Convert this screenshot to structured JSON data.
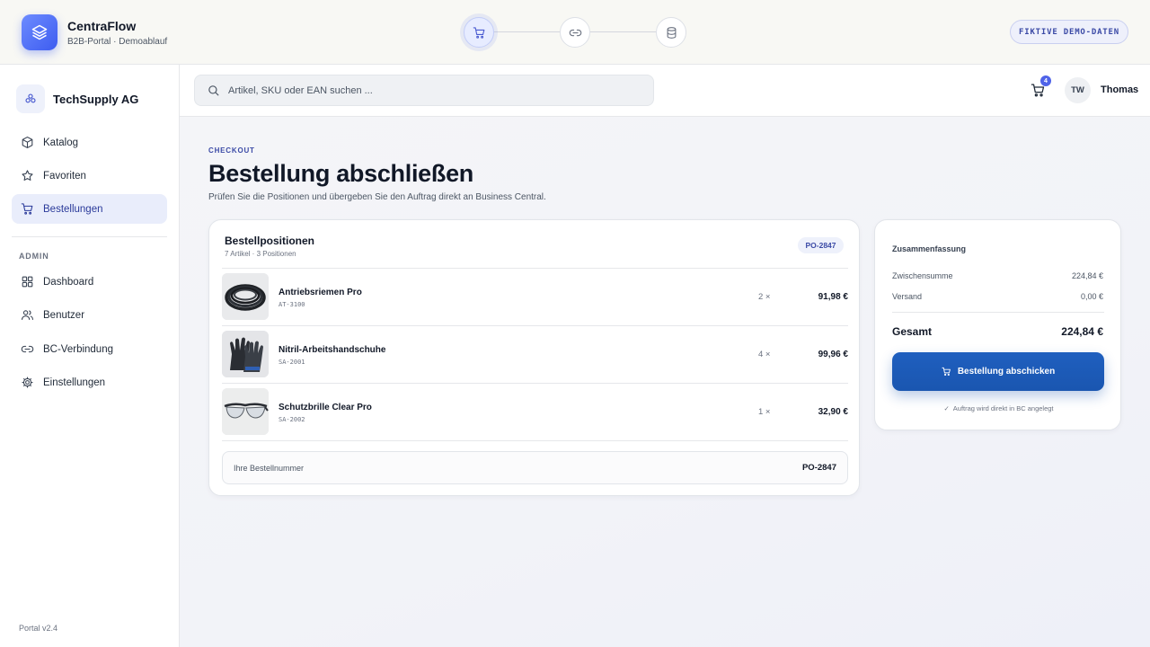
{
  "brand": {
    "name": "CentraFlow",
    "subtitle": "B2B-Portal · Demoablauf"
  },
  "progress_steps": [
    {
      "icon": "cart-icon",
      "active": true
    },
    {
      "icon": "link-icon",
      "active": false
    },
    {
      "icon": "database-icon",
      "active": false
    }
  ],
  "demo_badge": "FIKTIVE DEMO-DATEN",
  "sidebar": {
    "company": "TechSupply AG",
    "items": [
      {
        "label": "Katalog",
        "icon": "box-icon",
        "active": false
      },
      {
        "label": "Favoriten",
        "icon": "star-icon",
        "active": false
      },
      {
        "label": "Bestellungen",
        "icon": "cart-icon",
        "active": true
      }
    ],
    "admin_label": "ADMIN",
    "admin_items": [
      {
        "label": "Dashboard",
        "icon": "grid-icon"
      },
      {
        "label": "Benutzer",
        "icon": "users-icon"
      },
      {
        "label": "BC-Verbindung",
        "icon": "link-icon"
      },
      {
        "label": "Einstellungen",
        "icon": "gear-icon"
      }
    ],
    "version": "Portal v2.4"
  },
  "header": {
    "search_placeholder": "Artikel, SKU oder EAN suchen ...",
    "cart_count": "4",
    "avatar_initials": "TW",
    "user_name": "Thomas"
  },
  "page": {
    "eyebrow": "CHECKOUT",
    "title": "Bestellung abschließen",
    "description": "Prüfen Sie die Positionen und übergeben Sie den Auftrag direkt an Business Central."
  },
  "order": {
    "title": "Bestellpositionen",
    "subtitle": "7 Artikel · 3 Positionen",
    "po_badge": "PO-2847",
    "items": [
      {
        "name": "Antriebsriemen Pro",
        "sku": "AT-3100",
        "qty": "2 ×",
        "price": "91,98 €",
        "thumb": "belt"
      },
      {
        "name": "Nitril-Arbeitshandschuhe",
        "sku": "SA-2001",
        "qty": "4 ×",
        "price": "99,96 €",
        "thumb": "gloves"
      },
      {
        "name": "Schutzbrille Clear Pro",
        "sku": "SA-2002",
        "qty": "1 ×",
        "price": "32,90 €",
        "thumb": "glasses"
      }
    ],
    "po_field_label": "Ihre Bestellnummer",
    "po_field_value": "PO-2847"
  },
  "summary": {
    "title": "Zusammenfassung",
    "subtotal_label": "Zwischensumme",
    "subtotal_value": "224,84 €",
    "shipping_label": "Versand",
    "shipping_value": "0,00 €",
    "total_label": "Gesamt",
    "total_value": "224,84 €",
    "submit_label": "Bestellung abschicken",
    "hint": "Auftrag wird direkt in BC angelegt"
  },
  "colors": {
    "accent": "#3d5cf0",
    "primary_button": "#1a56b0",
    "active_nav_bg": "#e9edfb"
  }
}
